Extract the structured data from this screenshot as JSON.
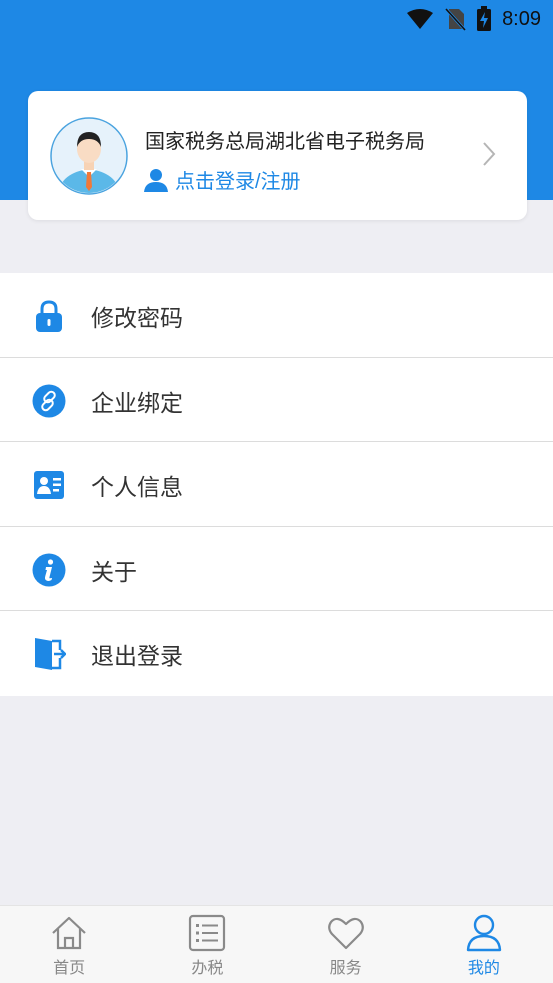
{
  "status_bar": {
    "time": "8:09",
    "icons": [
      "wifi-icon",
      "no-sim-icon",
      "battery-charging-icon"
    ]
  },
  "colors": {
    "primary": "#1e88e5",
    "background": "#eeeef3",
    "text": "#333333",
    "tab_inactive": "#888888"
  },
  "profile": {
    "org_name": "国家税务总局湖北省电子税务局",
    "login_label": "点击登录/注册",
    "icons": [
      "avatar-icon",
      "user-icon",
      "chevron-right-icon"
    ]
  },
  "menu": {
    "items": [
      {
        "label": "修改密码",
        "icon": "lock-icon"
      },
      {
        "label": "企业绑定",
        "icon": "link-icon"
      },
      {
        "label": "个人信息",
        "icon": "id-card-icon"
      },
      {
        "label": "关于",
        "icon": "info-icon"
      },
      {
        "label": "退出登录",
        "icon": "logout-icon"
      }
    ]
  },
  "tabbar": {
    "tabs": [
      {
        "label": "首页",
        "icon": "home-icon",
        "active": false
      },
      {
        "label": "办税",
        "icon": "list-icon",
        "active": false
      },
      {
        "label": "服务",
        "icon": "heart-icon",
        "active": false
      },
      {
        "label": "我的",
        "icon": "person-icon",
        "active": true
      }
    ]
  }
}
